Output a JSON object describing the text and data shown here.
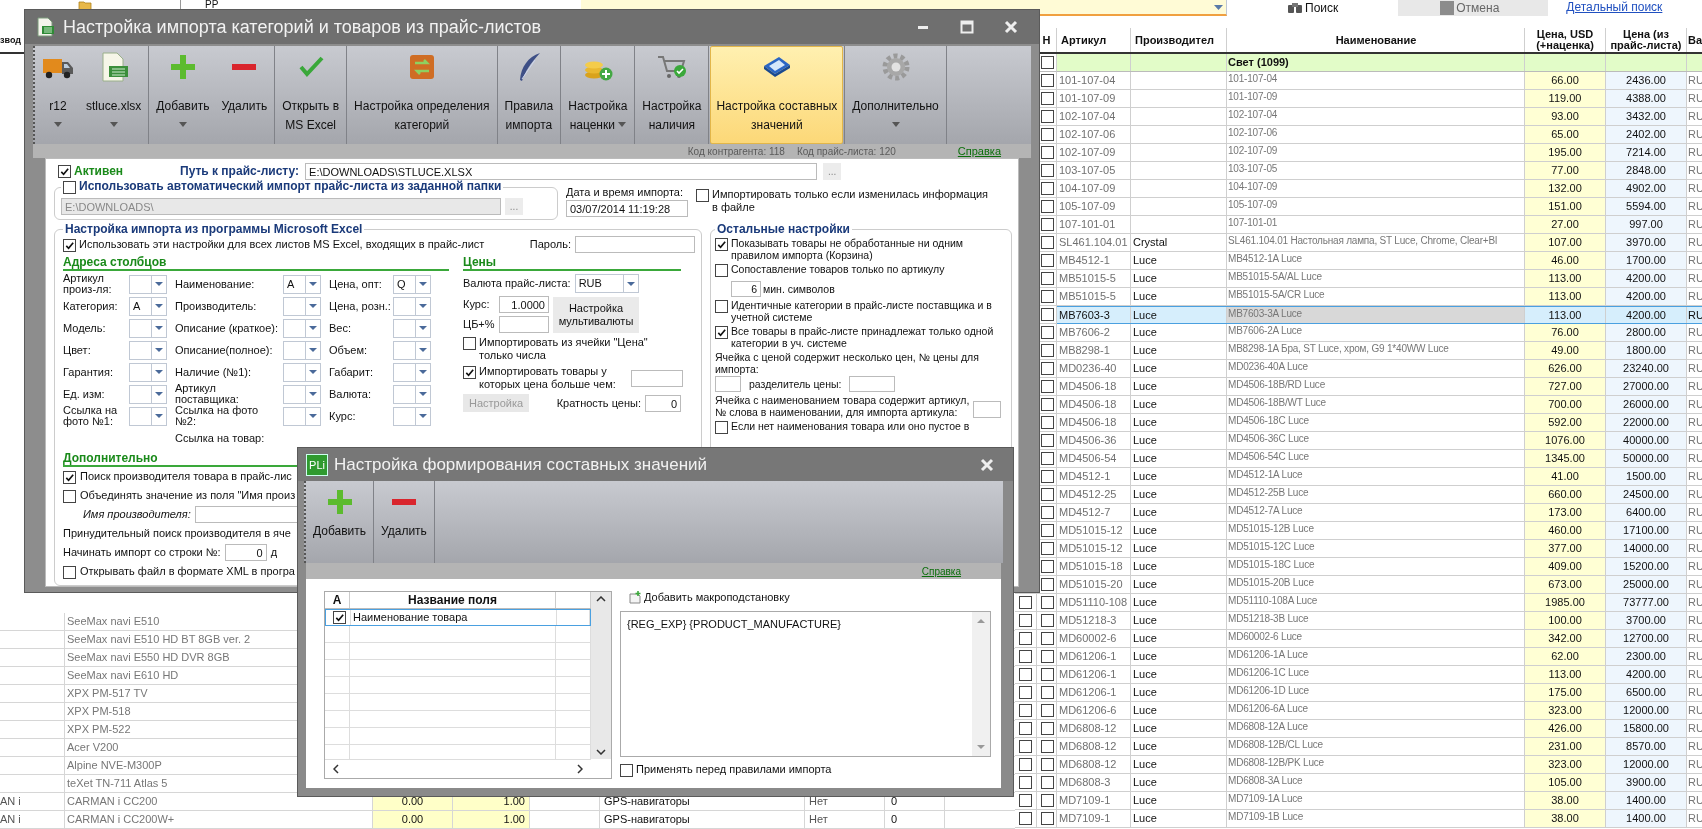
{
  "background": {
    "top_cell": "PP",
    "search_button": "Поиск",
    "cancel_button": "Отмена",
    "detail_link": "Детальный поиск",
    "left_table": {
      "header": "звод",
      "rows": [
        {
          "name": "SeeMax navi E510"
        },
        {
          "name": "SeeMax navi E510 HD BT 8GB ver. 2"
        },
        {
          "name": "SeeMax navi E550 HD DVR 8GB"
        },
        {
          "name": "SeeMax navi E610 HD"
        },
        {
          "name": "XPX PM-517 TV"
        },
        {
          "name": "XPX PM-518"
        },
        {
          "name": "XPX PM-522"
        },
        {
          "name": "Acer V200"
        },
        {
          "name": "Alpine NVE-M300P"
        },
        {
          "name": "teXet TN-711 Atlas 5"
        },
        {
          "col_1": "AN i",
          "name": "CARMAN i CC200",
          "price_1": "0.00",
          "price_2": "1.00",
          "category": "GPS-навигаторы",
          "stock": "Нет",
          "count": "0"
        },
        {
          "col_1": "AN i",
          "name": "CARMAN i CC200W+",
          "price_1": "0.00",
          "price_2": "1.00",
          "category": "GPS-навигаторы",
          "stock": "Нет",
          "count": "0"
        }
      ]
    },
    "right_table": {
      "columns": [
        "Н",
        "Артикул",
        "Производител",
        "Наименование",
        "Цена, USD (+наценка)",
        "Цена (из прайс-листа)",
        "Ва"
      ],
      "group": {
        "title": "Свет (1099)",
        "checked": false
      },
      "rows": [
        {
          "article": "101-107-04",
          "name": "101-107-04",
          "price_usd": "66.00",
          "price_list": "2436.00",
          "currency": "RU",
          "checked": false,
          "selected": false
        },
        {
          "article": "101-107-09",
          "name": "101-107-09",
          "price_usd": "119.00",
          "price_list": "4388.00",
          "currency": "RU",
          "checked": false,
          "selected": false
        },
        {
          "article": "102-107-04",
          "name": "102-107-04",
          "price_usd": "93.00",
          "price_list": "3432.00",
          "currency": "RU",
          "checked": false,
          "selected": false
        },
        {
          "article": "102-107-06",
          "name": "102-107-06",
          "price_usd": "65.00",
          "price_list": "2402.00",
          "currency": "RU",
          "checked": false,
          "selected": false
        },
        {
          "article": "102-107-09",
          "name": "102-107-09",
          "price_usd": "195.00",
          "price_list": "7214.00",
          "currency": "RU",
          "checked": false,
          "selected": false
        },
        {
          "article": "103-107-05",
          "name": "103-107-05",
          "price_usd": "77.00",
          "price_list": "2848.00",
          "currency": "RU",
          "checked": false,
          "selected": false
        },
        {
          "article": "104-107-09",
          "name": "104-107-09",
          "price_usd": "132.00",
          "price_list": "4902.00",
          "currency": "RU",
          "checked": false,
          "selected": false
        },
        {
          "article": "105-107-09",
          "name": "105-107-09",
          "price_usd": "151.00",
          "price_list": "5594.00",
          "currency": "RU",
          "checked": false,
          "selected": false
        },
        {
          "article": "107-101-01",
          "name": "107-101-01",
          "price_usd": "27.00",
          "price_list": "997.00",
          "currency": "RU",
          "checked": false,
          "selected": false
        },
        {
          "article": "SL461.104.01",
          "maker": "Crystal",
          "name": "SL461.104.01 Настольная лампа, ST Luce, Chrome, Clear+Bl",
          "price_usd": "107.00",
          "price_list": "3970.00",
          "currency": "RU",
          "checked": false,
          "selected": false
        },
        {
          "article": "MB4512-1",
          "maker": "Luce",
          "name": "MB4512-1A Luce",
          "price_usd": "46.00",
          "price_list": "1700.00",
          "currency": "RU",
          "checked": false,
          "selected": false
        },
        {
          "article": "MB51015-5",
          "maker": "Luce",
          "name": "MB51015-5A/AL Luce",
          "price_usd": "113.00",
          "price_list": "4200.00",
          "currency": "RU",
          "checked": false,
          "selected": false
        },
        {
          "article": "MB51015-5",
          "maker": "Luce",
          "name": "MB51015-5A/CR Luce",
          "price_usd": "113.00",
          "price_list": "4200.00",
          "currency": "RU",
          "checked": false,
          "selected": false
        },
        {
          "article": "MB7603-3",
          "maker": "Luce",
          "name": "MB7603-3A Luce",
          "price_usd": "113.00",
          "price_list": "4200.00",
          "currency": "RU",
          "checked": false,
          "selected": true
        },
        {
          "article": "MB7606-2",
          "maker": "Luce",
          "name": "MB7606-2A Luce",
          "price_usd": "76.00",
          "price_list": "2800.00",
          "currency": "RU",
          "checked": false,
          "selected": false
        },
        {
          "article": "MB8298-1",
          "maker": "Luce",
          "name": "MB8298-1A Бра, ST Luce, хром, G9 1*40WW Luce",
          "price_usd": "49.00",
          "price_list": "1800.00",
          "currency": "RU",
          "checked": false,
          "selected": false
        },
        {
          "article": "MD0236-40",
          "maker": "Luce",
          "name": "MD0236-40A Luce",
          "price_usd": "626.00",
          "price_list": "23240.00",
          "currency": "RU",
          "checked": false,
          "selected": false
        },
        {
          "article": "MD4506-18",
          "maker": "Luce",
          "name": "MD4506-18B/RD Luce",
          "price_usd": "727.00",
          "price_list": "27000.00",
          "currency": "RU",
          "checked": false,
          "selected": false
        },
        {
          "article": "MD4506-18",
          "maker": "Luce",
          "name": "MD4506-18B/WT Luce",
          "price_usd": "700.00",
          "price_list": "26000.00",
          "currency": "RU",
          "checked": false,
          "selected": false
        },
        {
          "article": "MD4506-18",
          "maker": "Luce",
          "name": "MD4506-18C Luce",
          "price_usd": "592.00",
          "price_list": "22000.00",
          "currency": "RU",
          "checked": false,
          "selected": false
        },
        {
          "article": "MD4506-36",
          "maker": "Luce",
          "name": "MD4506-36C Luce",
          "price_usd": "1076.00",
          "price_list": "40000.00",
          "currency": "RU",
          "checked": false,
          "selected": false
        },
        {
          "article": "MD4506-54",
          "maker": "Luce",
          "name": "MD4506-54C Luce",
          "price_usd": "1345.00",
          "price_list": "50000.00",
          "currency": "RU",
          "checked": false,
          "selected": false
        },
        {
          "article": "MD4512-1",
          "maker": "Luce",
          "name": "MD4512-1A Luce",
          "price_usd": "41.00",
          "price_list": "1500.00",
          "currency": "RU",
          "checked": false,
          "selected": false
        },
        {
          "article": "MD4512-25",
          "maker": "Luce",
          "name": "MD4512-25B Luce",
          "price_usd": "660.00",
          "price_list": "24500.00",
          "currency": "RU",
          "checked": false,
          "selected": false
        },
        {
          "article": "MD4512-7",
          "maker": "Luce",
          "name": "MD4512-7A Luce",
          "price_usd": "173.00",
          "price_list": "6400.00",
          "currency": "RU",
          "checked": false,
          "selected": false
        },
        {
          "article": "MD51015-12",
          "maker": "Luce",
          "name": "MD51015-12B Luce",
          "price_usd": "460.00",
          "price_list": "17100.00",
          "currency": "RU",
          "checked": false,
          "selected": false
        },
        {
          "article": "MD51015-12",
          "maker": "Luce",
          "name": "MD51015-12C Luce",
          "price_usd": "377.00",
          "price_list": "14000.00",
          "currency": "RU",
          "checked": false,
          "selected": false
        },
        {
          "article": "MD51015-18",
          "maker": "Luce",
          "name": "MD51015-18C Luce",
          "price_usd": "409.00",
          "price_list": "15200.00",
          "currency": "RU",
          "checked": false,
          "selected": false
        },
        {
          "article": "MD51015-20",
          "maker": "Luce",
          "name": "MD51015-20B Luce",
          "price_usd": "673.00",
          "price_list": "25000.00",
          "currency": "RU",
          "checked": false,
          "selected": false
        },
        {
          "article": "MD51110-108",
          "maker": "Luce",
          "name": "MD51110-108A Luce",
          "price_usd": "1985.00",
          "price_list": "73777.00",
          "currency": "RU",
          "marked": false,
          "checked": false,
          "selected": false
        },
        {
          "article": "MD51218-3",
          "maker": "Luce",
          "name": "MD51218-3B Luce",
          "price_usd": "100.00",
          "price_list": "3700.00",
          "currency": "RU",
          "marked": false,
          "checked": false,
          "selected": false
        },
        {
          "article": "MD60002-6",
          "maker": "Luce",
          "name": "MD60002-6 Luce",
          "price_usd": "342.00",
          "price_list": "12700.00",
          "currency": "RU",
          "marked": false,
          "checked": false,
          "selected": false
        },
        {
          "article": "MD61206-1",
          "maker": "Luce",
          "name": "MD61206-1A Luce",
          "price_usd": "62.00",
          "price_list": "2300.00",
          "currency": "RU",
          "marked": false,
          "checked": false,
          "selected": false
        },
        {
          "article": "MD61206-1",
          "maker": "Luce",
          "name": "MD61206-1C Luce",
          "price_usd": "113.00",
          "price_list": "4200.00",
          "currency": "RU",
          "marked": false,
          "checked": false,
          "selected": false
        },
        {
          "article": "MD61206-1",
          "maker": "Luce",
          "name": "MD61206-1D Luce",
          "price_usd": "175.00",
          "price_list": "6500.00",
          "currency": "RU",
          "marked": false,
          "checked": false,
          "selected": false
        },
        {
          "article": "MD61206-6",
          "maker": "Luce",
          "name": "MD61206-6A Luce",
          "price_usd": "323.00",
          "price_list": "12000.00",
          "currency": "RU",
          "marked": false,
          "checked": false,
          "selected": false
        },
        {
          "article": "MD6808-12",
          "maker": "Luce",
          "name": "MD6808-12A Luce",
          "price_usd": "426.00",
          "price_list": "15800.00",
          "currency": "RU",
          "marked": false,
          "checked": false,
          "selected": false
        },
        {
          "article": "MD6808-12",
          "maker": "Luce",
          "name": "MD6808-12B/CL Luce",
          "price_usd": "231.00",
          "price_list": "8570.00",
          "currency": "RU",
          "marked": false,
          "checked": false,
          "selected": false
        },
        {
          "article": "MD6808-12",
          "maker": "Luce",
          "name": "MD6808-12B/PK Luce",
          "price_usd": "323.00",
          "price_list": "12000.00",
          "currency": "RU",
          "marked": false,
          "checked": false,
          "selected": false
        },
        {
          "article": "MD6808-3",
          "maker": "Luce",
          "name": "MD6808-3A Luce",
          "price_usd": "105.00",
          "price_list": "3900.00",
          "currency": "RU",
          "marked": false,
          "checked": false,
          "selected": false
        },
        {
          "article": "MD7109-1",
          "maker": "Luce",
          "name": "MD7109-1A Luce",
          "price_usd": "38.00",
          "price_list": "1400.00",
          "currency": "RU",
          "marked": false,
          "checked": false,
          "selected": false
        },
        {
          "article": "MD7109-1",
          "maker": "Luce",
          "name": "MD7109-1B Luce",
          "price_usd": "38.00",
          "price_list": "1400.00",
          "currency": "RU",
          "marked": false,
          "checked": false,
          "selected": false
        }
      ]
    }
  },
  "main_window": {
    "title": "Настройка импорта категорий и товаров из прайс-листов",
    "toolbar": {
      "groups": [
        [
          {
            "lines": [
              "r12"
            ],
            "dropdown": true,
            "selected": false
          },
          {
            "lines": [
              "stluce.xlsx"
            ],
            "dropdown": true,
            "selected": false
          }
        ],
        [
          {
            "lines": [
              "Добавить"
            ],
            "dropdown": true,
            "selected": false
          },
          {
            "lines": [
              "Удалить"
            ],
            "dropdown": false,
            "selected": false
          }
        ],
        [
          {
            "lines": [
              "Открыть в",
              "MS Excel"
            ],
            "dropdown": false,
            "selected": false
          }
        ],
        [
          {
            "lines": [
              "Настройка определения",
              "категорий"
            ],
            "dropdown": false,
            "selected": false
          }
        ],
        [
          {
            "lines": [
              "Правила",
              "импорта"
            ],
            "dropdown": false,
            "selected": false
          }
        ],
        [
          {
            "lines": [
              "Настройка",
              "наценки"
            ],
            "dropdown": true,
            "selected": false
          }
        ],
        [
          {
            "lines": [
              "Настройка",
              "наличия"
            ],
            "dropdown": false,
            "selected": false
          }
        ],
        [
          {
            "lines": [
              "Настройка составных",
              "значений"
            ],
            "dropdown": false,
            "selected": true
          }
        ],
        [
          {
            "lines": [
              "Дополнительно"
            ],
            "dropdown": true,
            "selected": false
          }
        ]
      ]
    },
    "info": {
      "contractor_code": "Код контрагента: 118",
      "pricelist_code": "Код прайс-листа: 120",
      "help_link": "Справка"
    },
    "source": {
      "active": {
        "label": "Активен",
        "checked": true
      },
      "path_label": "Путь к прайс-листу:",
      "path": "E:\\DOWNLOADS\\STLUCE.XLSX",
      "browse": "...",
      "auto_import": {
        "label": "Использовать автоматический импорт прайс-листа из заданной папки",
        "checked": false
      },
      "folder": "E:\\DOWNLOADS\\",
      "folder_disabled": true,
      "folder_browse": "...",
      "date_label": "Дата и время импорта:",
      "date": "03/07/2014 11:19:28",
      "only_changed": {
        "label": "Импортировать только если изменилась информация в файле",
        "checked": false
      }
    },
    "excel": {
      "title": "Настройка импорта из программы Microsoft Excel",
      "all_sheets": {
        "label": "Использовать эти настройки для всех листов MS Excel, входящих в прайс-лист",
        "checked": true
      },
      "password_label": "Пароль:",
      "columns_title": "Адреса столбцов",
      "column_fields": [
        [
          {
            "kind": "combo",
            "label": "Артикул произ-ля:"
          },
          {
            "kind": "combo",
            "label": "Категория:",
            "value": "A"
          },
          {
            "kind": "combo",
            "label": "Модель:"
          },
          {
            "kind": "combo",
            "label": "Цвет:"
          },
          {
            "kind": "combo",
            "label": "Гарантия:"
          },
          {
            "kind": "combo",
            "label": "Ед. изм:"
          },
          {
            "kind": "combo",
            "label": "Ссылка на фото №1:"
          }
        ],
        [
          {
            "kind": "combo",
            "label": "Наименование:",
            "value": "A"
          },
          {
            "kind": "combo",
            "label": "Производитель:"
          },
          {
            "kind": "combo",
            "label": "Описание (краткое):"
          },
          {
            "kind": "combo",
            "label": "Описание(полное):"
          },
          {
            "kind": "combo",
            "label": "Наличие (№1):"
          },
          {
            "kind": "combo",
            "label": "Артикул поставщика:"
          },
          {
            "kind": "combo",
            "label": "Ссылка на фото №2:"
          },
          {
            "kind": "label",
            "label": "Ссылка на товар:"
          }
        ],
        [
          {
            "kind": "combo",
            "label": "Цена, опт:",
            "value": "Q"
          },
          {
            "kind": "combo",
            "label": "Цена, розн.:"
          },
          {
            "kind": "combo",
            "label": "Вес:"
          },
          {
            "kind": "combo",
            "label": "Объем:"
          },
          {
            "kind": "combo",
            "label": "Габарит:"
          },
          {
            "kind": "combo",
            "label": "Валюта:"
          },
          {
            "kind": "combo",
            "label": "Курс:"
          }
        ]
      ],
      "prices": {
        "title": "Цены",
        "currency_label": "Валюта прайс-листа:",
        "currency": "RUB",
        "rate_label": "Курс:",
        "rate": "1.0000",
        "cb_label": "ЦБ+%",
        "multicurrency_button": [
          "Настройка",
          "мультивалюты"
        ],
        "numbers_only": {
          "label": "Импортировать из ячейки \"Цена\" только числа",
          "checked": false
        },
        "min_price": {
          "label": "Импортировать товары у которых цена больше чем:",
          "checked": true
        },
        "settings_button": "Настройка",
        "settings_disabled": true,
        "multiplicity_label": "Кратность цены:",
        "multiplicity": "0"
      },
      "extra": {
        "title": "Дополнительно",
        "find_maker": {
          "label": "Поиск производителя товара в прайс-лис",
          "checked": true
        },
        "merge": {
          "label": "Объединять значение из поля \"Имя произ",
          "checked": false
        },
        "maker_name_label": "Имя производителя:",
        "forced_search": "Принудительный поиск производителя в яче",
        "start_row_label": "Начинать импорт со строки №:",
        "start_row": "0",
        "start_row_tail": "д",
        "xml": {
          "label": "Открывать файл в формате XML в програ",
          "checked": false
        }
      }
    },
    "other": {
      "title": "Остальные настройки",
      "options": [
        {
          "kind": "check",
          "label": "Показывать товары не обработанные ни одним правилом импорта (Корзина)",
          "checked": true
        },
        {
          "kind": "check",
          "label": "Сопоставление товаров только по артикулу",
          "checked": false,
          "min_length": "6",
          "min_length_label": "мин. символов"
        },
        {
          "kind": "check",
          "label": "Идентичные категории в прайс-листе поставщика и в учетной системе",
          "checked": false
        },
        {
          "kind": "check",
          "label": "Все товары в прайс-листе принадлежат только одной категории в уч. системе",
          "checked": true
        },
        {
          "kind": "split",
          "label": "Ячейка с ценой содержит несколько цен, № цены для импорта:",
          "separator_label": "разделитель цены:"
        },
        {
          "kind": "field",
          "label": "Ячейка с наименованием товара содержит артикул, № слова в наименовании, для импорта артикула:"
        },
        {
          "kind": "check",
          "label": "Если нет наименования товара или оно пустое в",
          "checked": false
        }
      ]
    }
  },
  "dialog": {
    "logo": "PLi",
    "title": "Настройка формирования составных значений",
    "toolbar": [
      "Добавить",
      "Удалить"
    ],
    "help_link": "Справка",
    "fields_table": {
      "columns": [
        "А",
        "Название поля"
      ],
      "rows": [
        {
          "checked": true,
          "name": "Наименование товара",
          "selected": true
        }
      ]
    },
    "macro_button": "Добавить макроподстановку",
    "expression": "{REG_EXP} {PRODUCT_MANUFACTURE}",
    "apply_before": {
      "label": "Применять перед правилами импорта",
      "checked": false
    }
  }
}
